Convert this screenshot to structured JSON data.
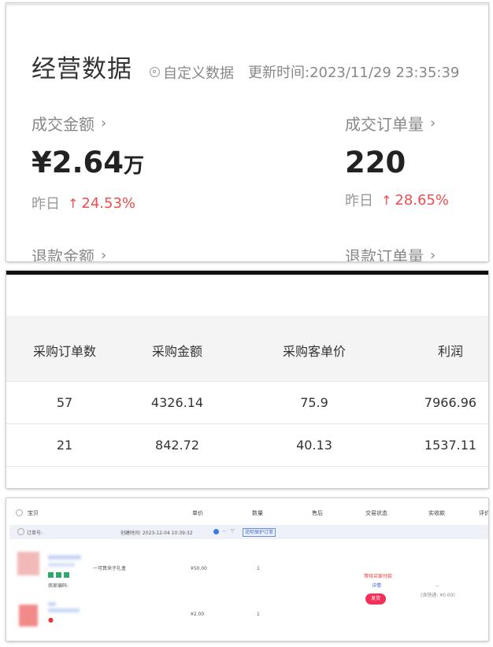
{
  "panel1": {
    "title": "经营数据",
    "custom_label": "自定义数据",
    "update_time": "更新时间:2023/11/29 23:35:39",
    "metrics": [
      {
        "label": "成交金额",
        "value": "¥2.64",
        "unit": "万",
        "yesterday_label": "昨日",
        "change": "24.53%"
      },
      {
        "label": "成交订单量",
        "value": "220",
        "unit": "",
        "yesterday_label": "昨日",
        "change": "28.65%"
      }
    ],
    "bottom_labels": [
      "退款金额",
      "退款订单量"
    ]
  },
  "panel2": {
    "headers": [
      "采购订单数",
      "采购金额",
      "采购客单价",
      "利润"
    ],
    "rows": [
      [
        "57",
        "4326.14",
        "75.9",
        "7966.96"
      ],
      [
        "21",
        "842.72",
        "40.13",
        "1537.11"
      ]
    ]
  },
  "panel3": {
    "headers": [
      "宝贝",
      "单价",
      "数量",
      "售后",
      "交易状态",
      "实收款",
      "评价"
    ],
    "order_no_label": "订单号:",
    "created_time": "创建时间: 2023-12-04 10:39:32",
    "protect_tag": "花呗保护订单",
    "item1": {
      "desc": "一可算来子礼盒",
      "merchant_code": "商家编码:",
      "price": "¥50.00",
      "qty": "1"
    },
    "item2": {
      "price": "¥2.00",
      "qty": "1"
    },
    "status_wait": "等待买家付款",
    "detail_link": "详情",
    "pay_button": "发货",
    "received": "(含快递: ¥0.00)",
    "received_dash": "--"
  },
  "colors": {
    "red": "#f04c4c",
    "pay": "#f2305a",
    "blue": "#3b6ad8"
  },
  "icons": [
    "gear-icon",
    "chevron-right-icon",
    "arrow-up-icon",
    "checkbox-circle-icon",
    "filter-icon",
    "flag-icon"
  ]
}
